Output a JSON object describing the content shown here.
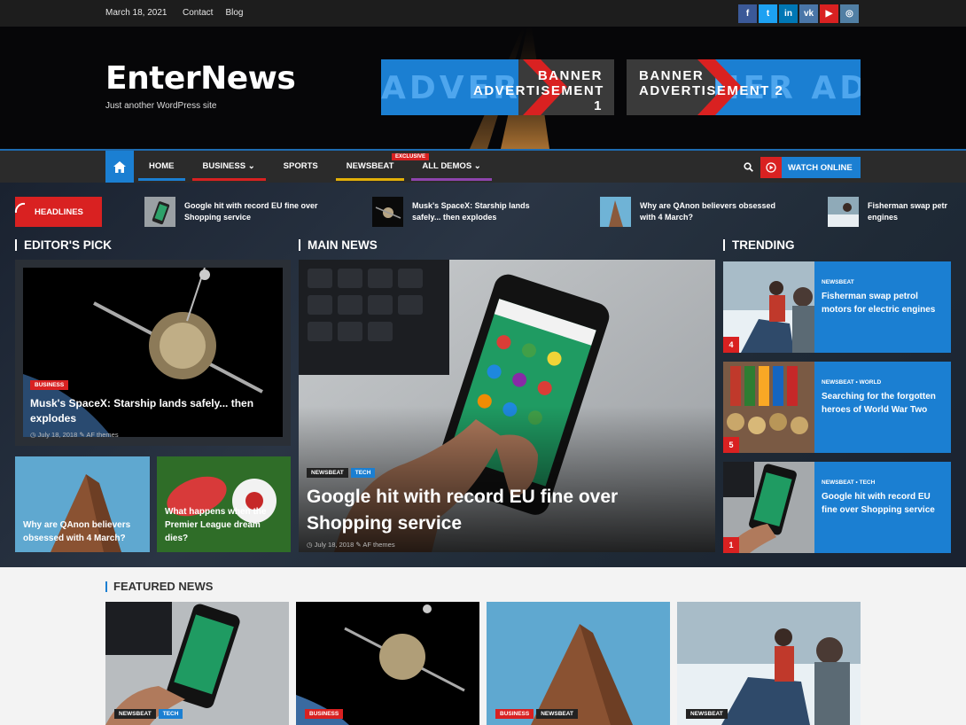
{
  "topbar": {
    "date": "March 18, 2021",
    "links": [
      "Contact",
      "Blog"
    ],
    "social": [
      {
        "icon": "facebook-icon",
        "glyph": "f",
        "color": "#3b5998"
      },
      {
        "icon": "twitter-icon",
        "glyph": "t",
        "color": "#1da1f2"
      },
      {
        "icon": "linkedin-icon",
        "glyph": "in",
        "color": "#0077b5"
      },
      {
        "icon": "vk-icon",
        "glyph": "vk",
        "color": "#4a76a8"
      },
      {
        "icon": "youtube-icon",
        "glyph": "▶",
        "color": "#d92121"
      },
      {
        "icon": "instagram-icon",
        "glyph": "◎",
        "color": "#517fa4"
      }
    ]
  },
  "header": {
    "logo": "EnterNews",
    "tagline": "Just another WordPress site",
    "banner1": {
      "line1": "BANNER",
      "line2": "ADVERTISEMENT 1",
      "bg": "ADVERTISEMENT"
    },
    "banner2": {
      "line1": "BANNER",
      "line2": "ADVERTISEMENT 2",
      "bg": "BANNER ADV"
    }
  },
  "nav": {
    "items": [
      {
        "label": "HOME",
        "accent": "#1b7fd2"
      },
      {
        "label": "BUSINESS ⌄",
        "accent": "#d92121"
      },
      {
        "label": "SPORTS",
        "accent": ""
      },
      {
        "label": "NEWSBEAT",
        "accent": "#e3b008"
      },
      {
        "label": "ALL DEMOS ⌄",
        "accent": "#8e44ad"
      }
    ],
    "exclusive_badge": "EXCLUSIVE",
    "watch_label": "WATCH ONLINE"
  },
  "headlines": {
    "label": "HEADLINES",
    "items": [
      "Google hit with record EU fine over Shopping service",
      "Musk's SpaceX: Starship lands safely... then explodes",
      "Why are QAnon believers obsessed with 4 March?",
      "Fisherman swap petr engines"
    ]
  },
  "sections": {
    "editors_pick": "EDITOR'S PICK",
    "main_news": "MAIN NEWS",
    "trending": "TRENDING",
    "featured": "FEATURED NEWS"
  },
  "editors": {
    "big": {
      "tag": "BUSINESS",
      "title": "Musk's SpaceX: Starship lands safely... then explodes",
      "date": "July 18, 2018",
      "author": "AF themes"
    },
    "small1": {
      "title": "Why are QAnon believers obsessed with 4 March?"
    },
    "small2": {
      "title": "What happens when the Premier League dream dies?"
    }
  },
  "main": {
    "tags": [
      "NEWSBEAT",
      "TECH"
    ],
    "title": "Google hit with record EU fine over Shopping service",
    "date": "July 18, 2018",
    "author": "AF themes"
  },
  "trending": [
    {
      "num": "4",
      "cat": "NEWSBEAT",
      "title": "Fisherman swap petrol motors for electric engines"
    },
    {
      "num": "5",
      "cat": "NEWSBEAT  •  WORLD",
      "title": "Searching for the forgotten heroes of World War Two"
    },
    {
      "num": "1",
      "cat": "NEWSBEAT  •  TECH",
      "title": "Google hit with record EU fine over Shopping service"
    }
  ],
  "featured": [
    {
      "tags": [
        {
          "t": "NEWSBEAT",
          "c": "dark"
        },
        {
          "t": "TECH",
          "c": "blue"
        }
      ]
    },
    {
      "tags": [
        {
          "t": "BUSINESS",
          "c": "red"
        }
      ]
    },
    {
      "tags": [
        {
          "t": "BUSINESS",
          "c": "red"
        },
        {
          "t": "NEWSBEAT",
          "c": "dark"
        }
      ]
    },
    {
      "tags": [
        {
          "t": "NEWSBEAT",
          "c": "dark"
        }
      ]
    }
  ]
}
